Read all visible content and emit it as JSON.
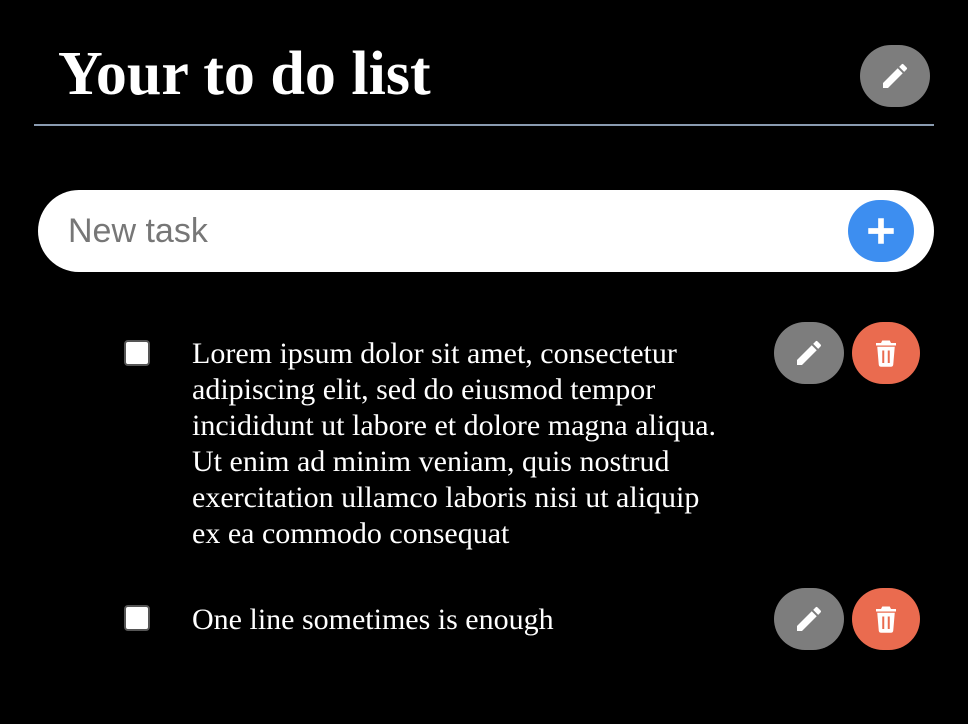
{
  "header": {
    "title": "Your to do list",
    "edit_icon": "pencil-icon"
  },
  "new_task": {
    "placeholder": "New task",
    "value": "",
    "add_icon": "plus-icon"
  },
  "tasks": [
    {
      "checked": false,
      "text": "Lorem ipsum dolor sit amet, consectetur adipiscing elit, sed do eiusmod tempor incididunt ut labore et dolore magna aliqua. Ut enim ad minim veniam, quis nostrud exercitation ullamco laboris nisi ut aliquip ex ea commodo consequat",
      "edit_icon": "pencil-icon",
      "delete_icon": "trash-icon"
    },
    {
      "checked": false,
      "text": "One line sometimes is enough",
      "edit_icon": "pencil-icon",
      "delete_icon": "trash-icon"
    }
  ],
  "colors": {
    "background": "#000000",
    "divider": "#8a9bb0",
    "edit_button": "#7d7d7d",
    "delete_button": "#ea6b4f",
    "add_button": "#3d8ef0",
    "text": "#ffffff"
  }
}
